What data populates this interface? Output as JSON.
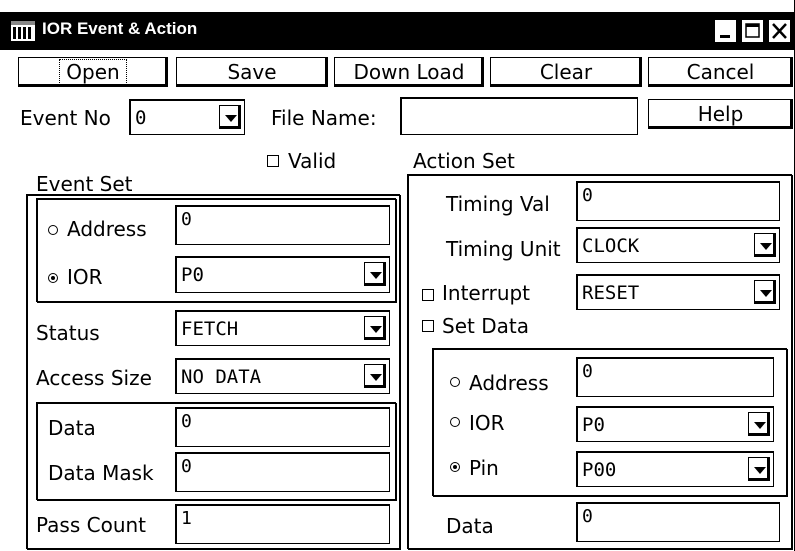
{
  "window": {
    "title": "IOR Event & Action"
  },
  "toolbar": {
    "open": "Open",
    "save": "Save",
    "download": "Down Load",
    "clear": "Clear",
    "cancel": "Cancel",
    "help": "Help"
  },
  "event_no": {
    "label": "Event No",
    "value": "0"
  },
  "file_name": {
    "label": "File Name:",
    "value": ""
  },
  "valid": {
    "label": "Valid",
    "checked": false
  },
  "event_set": {
    "title": "Event Set",
    "address_label": "Address",
    "address_value": "0",
    "ior_label": "IOR",
    "ior_value": "P0",
    "mode": "IOR",
    "status_label": "Status",
    "status_value": "FETCH",
    "access_size_label": "Access Size",
    "access_size_value": "NO DATA",
    "data_label": "Data",
    "data_value": "0",
    "data_mask_label": "Data Mask",
    "data_mask_value": "0",
    "pass_count_label": "Pass Count",
    "pass_count_value": "1"
  },
  "action_set": {
    "title": "Action Set",
    "timing_val_label": "Timing Val",
    "timing_val_value": "0",
    "timing_unit_label": "Timing Unit",
    "timing_unit_value": "CLOCK",
    "interrupt_label": "Interrupt",
    "interrupt_value": "RESET",
    "interrupt_checked": false,
    "set_data_label": "Set Data",
    "set_data_checked": false,
    "address_label": "Address",
    "address_value": "0",
    "ior_label": "IOR",
    "ior_value": "P0",
    "pin_label": "Pin",
    "pin_value": "P00",
    "mode": "Pin",
    "data_label": "Data",
    "data_value": "0"
  }
}
